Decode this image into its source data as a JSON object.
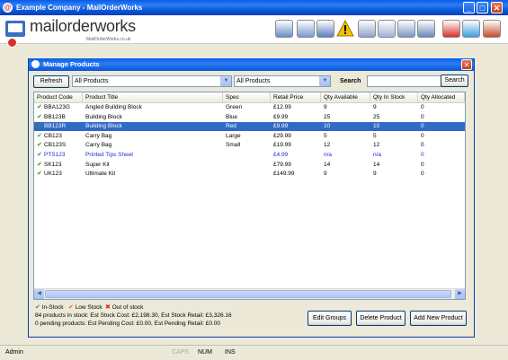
{
  "window": {
    "title": "Example Company - MailOrderWorks"
  },
  "logo": {
    "text": "mailorderworks",
    "sub": "MailOrderWorks.co.uk"
  },
  "toolbar": {
    "icons": [
      "order-add-icon",
      "order-search-icon",
      "order-list-icon",
      "warning-icon",
      "edit-document-icon",
      "info-document-icon",
      "product-add-icon",
      "product-edit-icon",
      "toolbox-icon",
      "cubes-icon",
      "users-icon"
    ]
  },
  "panel": {
    "title": "Manage Products",
    "refresh_label": "Refresh",
    "filter1": "All Products",
    "filter2": "All Products",
    "search_label": "Search",
    "search_button": "Search",
    "search_value": ""
  },
  "grid": {
    "columns": [
      "Product Code",
      "Product Title",
      "Spec",
      "Retail Price",
      "Qty Available",
      "Qty In Stock",
      "Qty Allocated"
    ],
    "rows": [
      {
        "code": "BBA123G",
        "title": "Angled Building Block",
        "spec": "Green",
        "price": "£12.99",
        "avail": "9",
        "stock": "9",
        "alloc": "0",
        "sel": false,
        "blue": false
      },
      {
        "code": "BB123B",
        "title": "Building Block",
        "spec": "Blue",
        "price": "£9.99",
        "avail": "25",
        "stock": "25",
        "alloc": "0",
        "sel": false,
        "blue": false
      },
      {
        "code": "BB123R",
        "title": "Building Block",
        "spec": "Red",
        "price": "£9.99",
        "avail": "10",
        "stock": "10",
        "alloc": "0",
        "sel": true,
        "blue": false
      },
      {
        "code": "CB123",
        "title": "Carry Bag",
        "spec": "Large",
        "price": "£29.99",
        "avail": "5",
        "stock": "5",
        "alloc": "0",
        "sel": false,
        "blue": false
      },
      {
        "code": "CB123S",
        "title": "Carry Bag",
        "spec": "Small",
        "price": "£19.99",
        "avail": "12",
        "stock": "12",
        "alloc": "0",
        "sel": false,
        "blue": false
      },
      {
        "code": "PTS123",
        "title": "Printed Tips Sheet",
        "spec": "",
        "price": "£4.99",
        "avail": "n/a",
        "stock": "n/a",
        "alloc": "0",
        "sel": false,
        "blue": true
      },
      {
        "code": "SK123",
        "title": "Super Kit",
        "spec": "",
        "price": "£79.99",
        "avail": "14",
        "stock": "14",
        "alloc": "0",
        "sel": false,
        "blue": false
      },
      {
        "code": "UK123",
        "title": "Ultimate Kit",
        "spec": "",
        "price": "£149.99",
        "avail": "9",
        "stock": "9",
        "alloc": "0",
        "sel": false,
        "blue": false
      }
    ]
  },
  "legend": {
    "in_stock": "In-Stock",
    "low_stock": "Low Stock",
    "out_of_stock": "Out of stock"
  },
  "colors": {
    "in_stock": "#2E9A2E",
    "low_stock": "#E06A10",
    "out_of_stock": "#D02020",
    "selection": "#316AC5"
  },
  "summary": {
    "line1": "84 products in stock: Est Stock Cost: £2,198.30, Est Stock Retail: £3,326.16",
    "line2": "0 pending products: Est Pending Cost: £0.00, Est Pending Retail: £0.00"
  },
  "actions": {
    "edit_groups": "Edit Groups",
    "delete_product": "Delete Product",
    "add_product": "Add New Product"
  },
  "statusbar": {
    "user": "Admin",
    "caps": "CAPS",
    "num": "NUM",
    "ins": "INS"
  }
}
